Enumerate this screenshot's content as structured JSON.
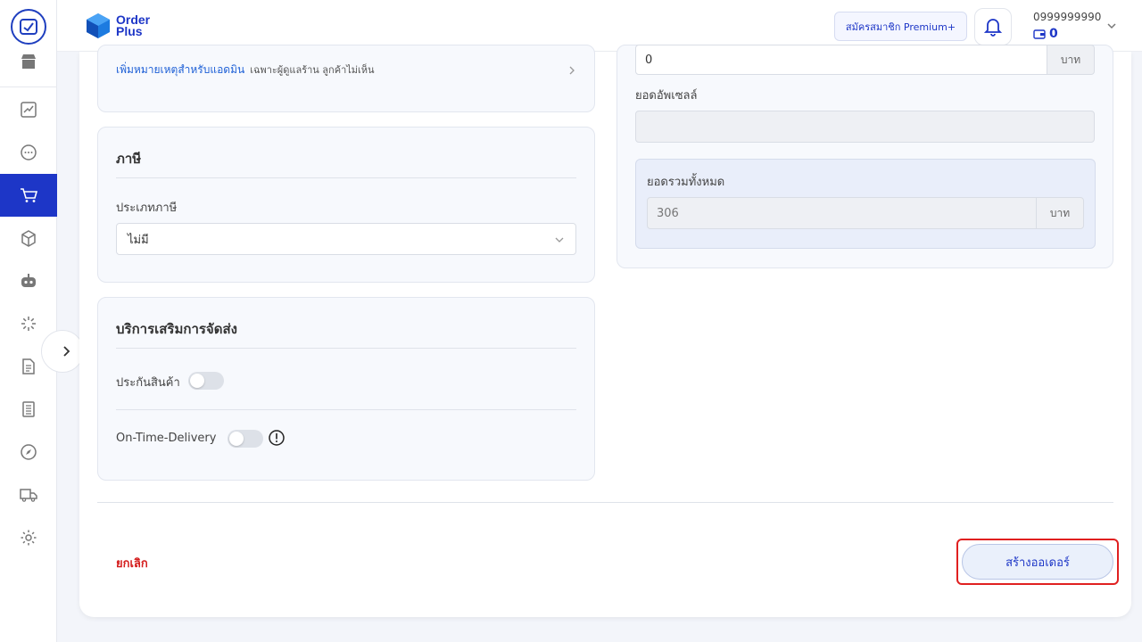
{
  "app": {
    "brand_line1": "Order",
    "brand_line2": "Plus"
  },
  "topbar": {
    "premium_label": "สมัครสมาชิก Premium+",
    "user_phone": "0999999990",
    "user_credit": "0"
  },
  "sidebar": {
    "items": [
      {
        "icon": "store-icon"
      },
      {
        "icon": "chart-icon"
      },
      {
        "icon": "chat-icon"
      },
      {
        "icon": "cart-icon",
        "active": true
      },
      {
        "icon": "box-icon"
      },
      {
        "icon": "robot-icon"
      },
      {
        "icon": "loader-icon"
      },
      {
        "icon": "document-icon"
      },
      {
        "icon": "ledger-icon"
      },
      {
        "icon": "compass-icon"
      },
      {
        "icon": "truck-icon"
      },
      {
        "icon": "gear-icon"
      }
    ]
  },
  "note": {
    "link_text": "เพิ่มหมายเหตุสำหรับแอดมิน",
    "hint": "เฉพาะผู้ดูแลร้าน ลูกค้าไม่เห็น"
  },
  "tax": {
    "title": "ภาษี",
    "type_label": "ประเภทภาษี",
    "type_value": "ไม่มี"
  },
  "shipping_addons": {
    "title": "บริการเสริมการจัดส่ง",
    "insurance_label": "ประกันสินค้า",
    "insurance_on": false,
    "otd_label": "On-Time-Delivery",
    "otd_on": false
  },
  "summary": {
    "top_value": "0",
    "currency": "บาท",
    "upsell_label": "ยอดอัพเซลล์",
    "upsell_value": "",
    "total_label": "ยอดรวมทั้งหมด",
    "total_value": "306"
  },
  "actions": {
    "cancel_label": "ยกเลิก",
    "create_label": "สร้างออเดอร์"
  },
  "colors": {
    "accent": "#1d36c7",
    "danger": "#d41c1c",
    "highlight": "#e02020"
  }
}
